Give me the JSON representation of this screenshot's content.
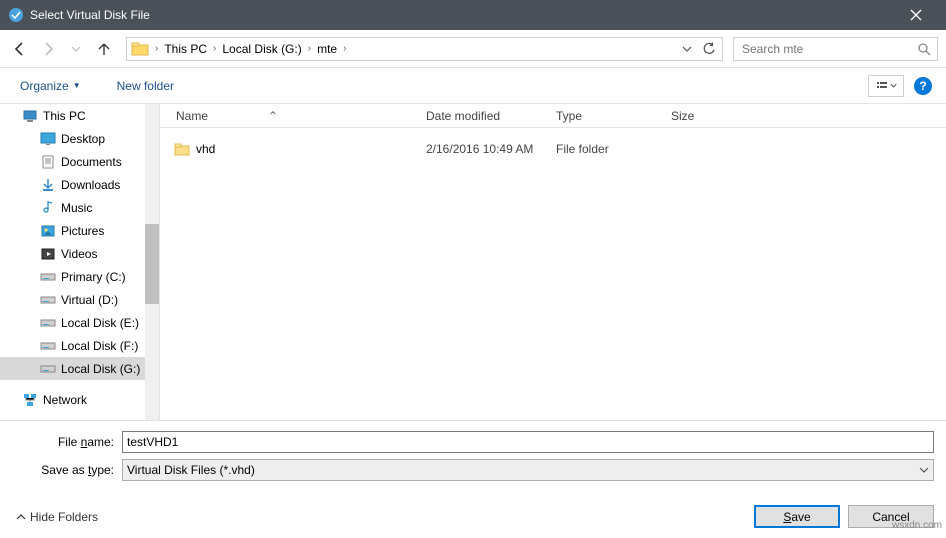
{
  "window": {
    "title": "Select Virtual Disk File"
  },
  "nav": {
    "breadcrumbs": [
      "This PC",
      "Local Disk (G:)",
      "mte"
    ],
    "search_placeholder": "Search mte"
  },
  "toolbar": {
    "organize": "Organize",
    "new_folder": "New folder"
  },
  "sidebar": {
    "items": [
      {
        "label": "This PC",
        "icon": "pc"
      },
      {
        "label": "Desktop",
        "icon": "desktop"
      },
      {
        "label": "Documents",
        "icon": "documents"
      },
      {
        "label": "Downloads",
        "icon": "downloads"
      },
      {
        "label": "Music",
        "icon": "music"
      },
      {
        "label": "Pictures",
        "icon": "pictures"
      },
      {
        "label": "Videos",
        "icon": "videos"
      },
      {
        "label": "Primary (C:)",
        "icon": "drive"
      },
      {
        "label": "Virtual (D:)",
        "icon": "drive"
      },
      {
        "label": "Local Disk (E:)",
        "icon": "drive"
      },
      {
        "label": "Local Disk (F:)",
        "icon": "drive"
      },
      {
        "label": "Local Disk (G:)",
        "icon": "drive"
      },
      {
        "label": "Network",
        "icon": "network"
      }
    ]
  },
  "columns": {
    "name": "Name",
    "date": "Date modified",
    "type": "Type",
    "size": "Size"
  },
  "files": [
    {
      "name": "vhd",
      "date": "2/16/2016 10:49 AM",
      "type": "File folder"
    }
  ],
  "form": {
    "filename_label": "File name:",
    "filename_value": "testVHD1",
    "savetype_label": "Save as type:",
    "savetype_value": "Virtual Disk Files (*.vhd)"
  },
  "actions": {
    "hide_folders": "Hide Folders",
    "save": "Save",
    "cancel": "Cancel"
  },
  "watermark": "wsxdn.com"
}
